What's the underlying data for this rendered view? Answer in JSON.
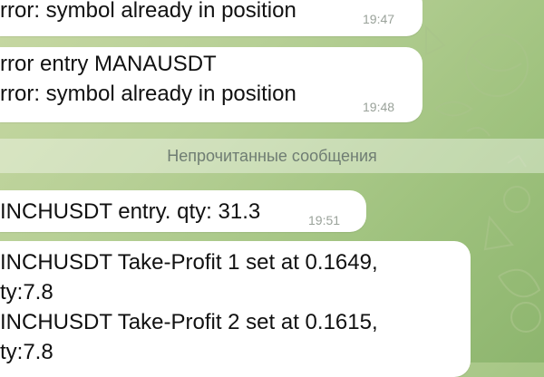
{
  "messages": [
    {
      "lines": [
        "rror: symbol already in position"
      ],
      "time": "19:47"
    },
    {
      "lines": [
        "rror entry MANAUSDT",
        "rror: symbol already in position"
      ],
      "time": "19:48"
    },
    {
      "lines": [
        "INCHUSDT entry. qty: 31.3"
      ],
      "time": "19:51"
    },
    {
      "lines": [
        "INCHUSDT Take-Profit 1 set at 0.1649,",
        "ty:7.8",
        "INCHUSDT Take-Profit 2 set at 0.1615,",
        "ty:7.8"
      ],
      "time": ""
    }
  ],
  "divider": {
    "label": "Непрочитанные сообщения"
  },
  "colors": {
    "bubble": "#ffffff",
    "wallpaper": "#b3cd91",
    "divider_text": "#6f7d73",
    "time_text": "#9aa29a"
  }
}
